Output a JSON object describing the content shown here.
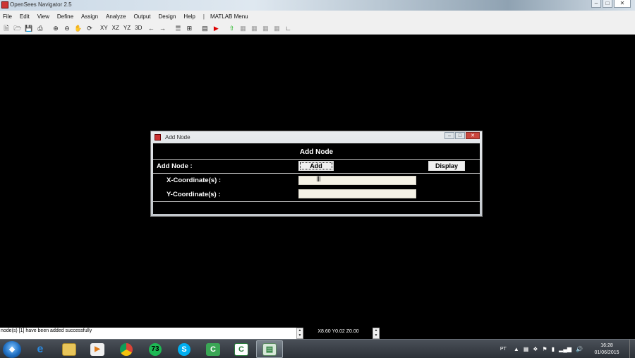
{
  "window": {
    "title": "OpenSees Navigator 2.5"
  },
  "menu": {
    "items": [
      "File",
      "Edit",
      "View",
      "Define",
      "Assign",
      "Analyze",
      "Output",
      "Design",
      "Help"
    ],
    "separator": "|",
    "matlab": "MATLAB Menu"
  },
  "toolbar": {
    "view_xy": "XY",
    "view_xz": "XZ",
    "view_yz": "YZ",
    "view_3d": "3D"
  },
  "dialog": {
    "title": "Add Node",
    "header": "Add Node",
    "add_node_label": "Add Node :",
    "add_button": "Add",
    "display_button": "Display",
    "x_label": "X-Coordinate(s) :",
    "y_label": "Y-Coordinate(s) :",
    "x_value": "",
    "y_value": ""
  },
  "status": {
    "message": "node(s) [1] have been added successfully",
    "coords": "X8.60 Y0.02 Z0.00"
  },
  "taskbar": {
    "lang": "PT",
    "time": "16:28",
    "date": "01/06/2015",
    "spotify_badge": "73"
  }
}
